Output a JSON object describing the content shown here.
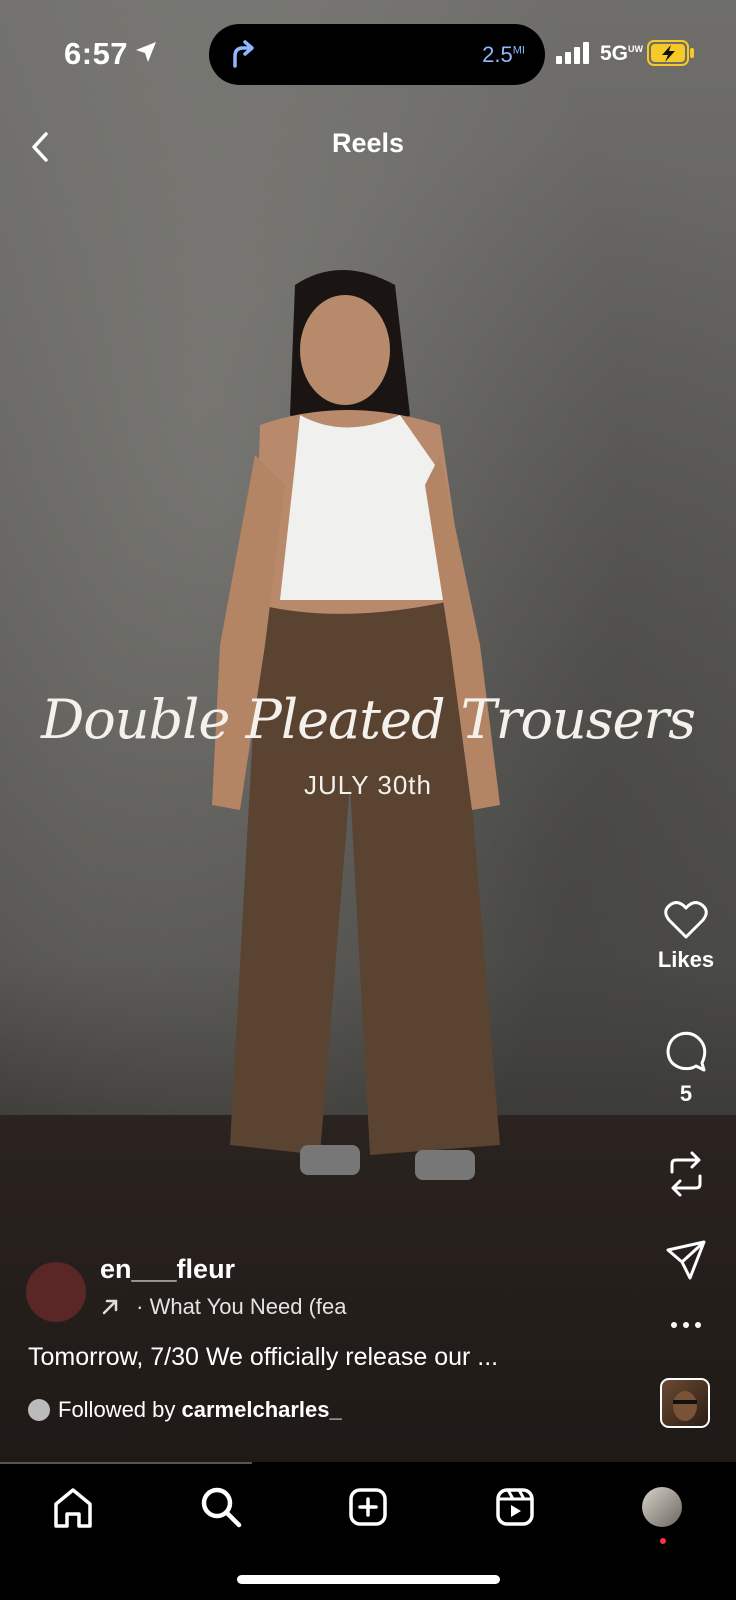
{
  "status": {
    "time": "6:57",
    "distance": "2.5",
    "distance_unit": "MI",
    "network": "5G",
    "network_sup": "UW"
  },
  "header": {
    "title": "Reels"
  },
  "reel": {
    "overlay_title": "Double Pleated Trousers",
    "overlay_date": "JULY 30th"
  },
  "actions": {
    "likes_label": "Likes",
    "comments_count": "5"
  },
  "post": {
    "username": "en___fleur",
    "audio": "· What You Need (fea",
    "caption": "Tomorrow, 7/30 We officially release our ...",
    "followed_prefix": "Followed by ",
    "followed_user": "carmelcharles_"
  },
  "icons": {
    "back": "chevron-left-icon",
    "like": "heart-icon",
    "comment": "comment-icon",
    "repost": "repost-icon",
    "share": "send-icon",
    "more": "more-icon",
    "home": "home-icon",
    "search": "search-icon",
    "create": "plus-square-icon",
    "reels": "reels-icon"
  },
  "colors": {
    "accent_blue": "#8fb8ff",
    "battery": "#f7c928",
    "notification": "#ff3040"
  }
}
